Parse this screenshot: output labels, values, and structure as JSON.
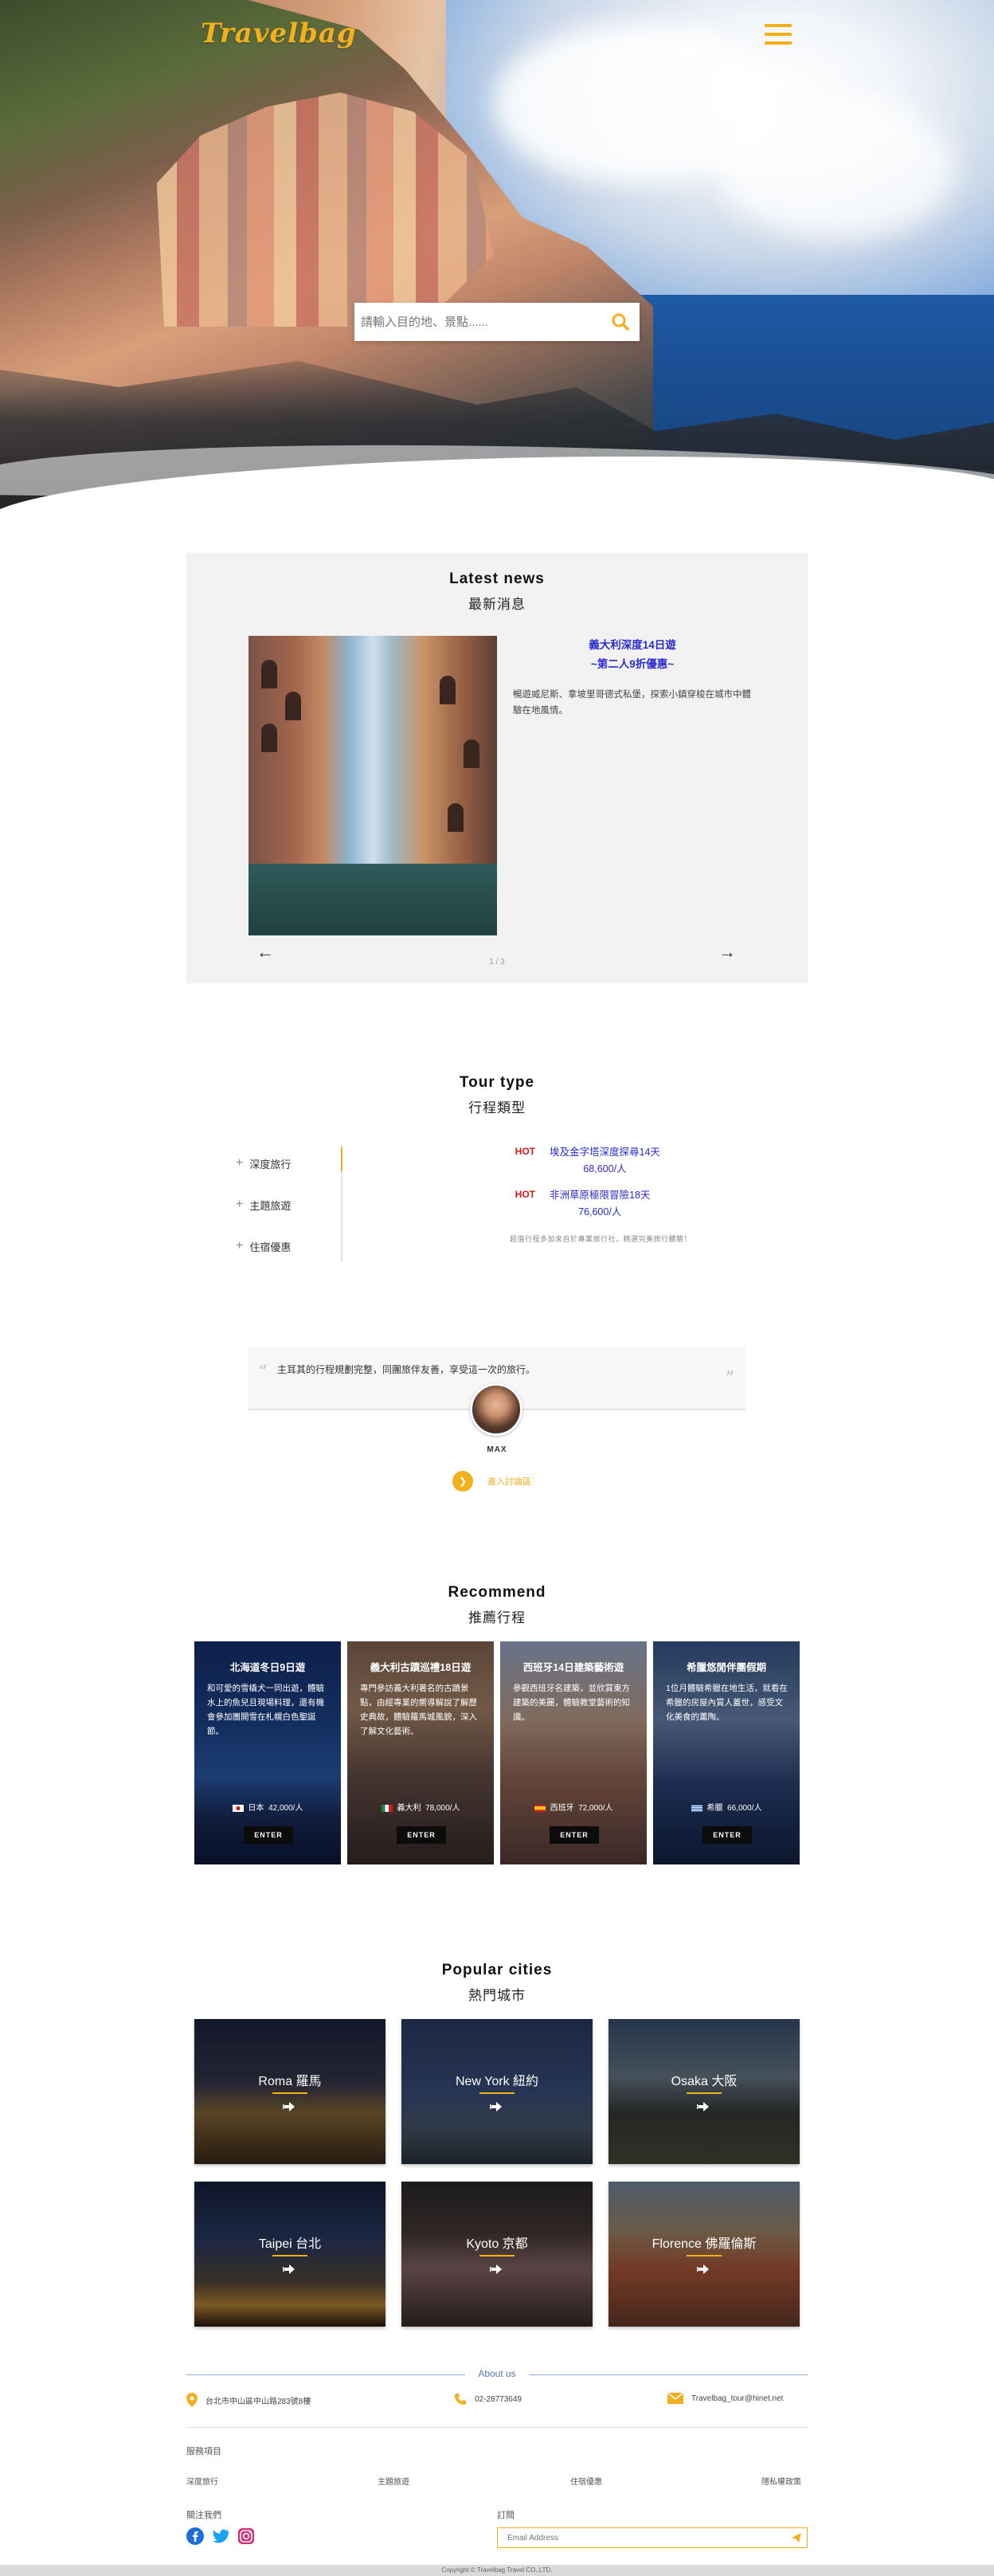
{
  "brand": {
    "logo_text": "Travelbag",
    "accent_color": "#f2b01e"
  },
  "header": {
    "menu_icon": "hamburger-menu-icon"
  },
  "hero": {
    "search_placeholder": "請輸入目的地、景點......",
    "search_icon": "search-icon"
  },
  "news": {
    "title_en": "Latest  news",
    "title_zh": "最新消息",
    "headline_line1": "義大利深度14日遊",
    "headline_line2": "~第二人9折優惠~",
    "body": "暢遊威尼斯、拿坡里哥德式私堡，探索小鎮穿梭在城市中體驗在地風情。",
    "prev_icon": "arrow-left-icon",
    "next_icon": "arrow-right-icon",
    "pager": "1 / 3"
  },
  "tour_type": {
    "title_en": "Tour  type",
    "title_zh": "行程類型",
    "categories": [
      "深度旅行",
      "主題旅遊",
      "住宿優惠"
    ],
    "offers": [
      {
        "badge": "HOT",
        "name": "埃及金字塔深度探尋14天",
        "price": "68,600/人"
      },
      {
        "badge": "HOT",
        "name": "非洲草原極限冒險18天",
        "price": "76,600/人"
      }
    ],
    "note": "超值行程多加來自於專業旅行社，精選完美旅行體驗！"
  },
  "testimonial": {
    "quote": "主耳其的行程規劃完整，同團旅伴友善，享受這一次的旅行。",
    "name": "MAX",
    "forum_label": "進入討論區"
  },
  "recommend": {
    "title_en": "Recommend",
    "title_zh": "推薦行程",
    "enter_label": "ENTER",
    "cards": [
      {
        "title": "北海道冬日9日遊",
        "desc": "和可愛的雪橇犬一同出遊，體驗水上的魚兒且現場料理，還有機會參加團開雪在札幌白色聖誕節。",
        "country": "日本",
        "price": "42,000/人"
      },
      {
        "title": "義大利古蹟巡禮18日遊",
        "desc": "專門參訪義大利著名的古蹟景點，由經專業的嚮導解說了解歷史典故，體驗羅馬城風貌，深入了解文化藝術。",
        "country": "義大利",
        "price": "78,000/人"
      },
      {
        "title": "西班牙14日建築藝術遊",
        "desc": "參觀西班牙名建築，並欣賞東方建築的美麗，體驗教堂藝術的知識。",
        "country": "西班牙",
        "price": "72,000/人"
      },
      {
        "title": "希臘悠閒伴團假期",
        "desc": "1位月體驗希臘在地生活，就看在希臘的房屋內賞人蓋世，感受文化美食的薰陶。",
        "country": "希臘",
        "price": "66,000/人"
      }
    ]
  },
  "cities": {
    "title_en": "Popular  cities",
    "title_zh": "熱門城市",
    "items": [
      {
        "name": "Roma  羅馬"
      },
      {
        "name": "New York  紐約"
      },
      {
        "name": "Osaka  大阪"
      },
      {
        "name": "Taipei  台北"
      },
      {
        "name": "Kyoto  京都"
      },
      {
        "name": "Florence  佛羅倫斯"
      }
    ]
  },
  "footer": {
    "about_label": "About us",
    "address": "台北市中山區中山路283號8樓",
    "phone": "02-28773649",
    "email": "Travelbag_tour@hinet.net",
    "services_heading": "服務項目",
    "services": [
      "深度旅行",
      "主題旅遊",
      "住宿優惠",
      "隱私權政策"
    ],
    "follow_heading": "關注我們",
    "subscribe_heading": "訂閱",
    "email_placeholder": "Email Address",
    "social_icons": [
      "facebook-icon",
      "twitter-icon",
      "instagram-icon"
    ],
    "copyright": "Copyright © Travelbag Travel CO.,LTD."
  }
}
